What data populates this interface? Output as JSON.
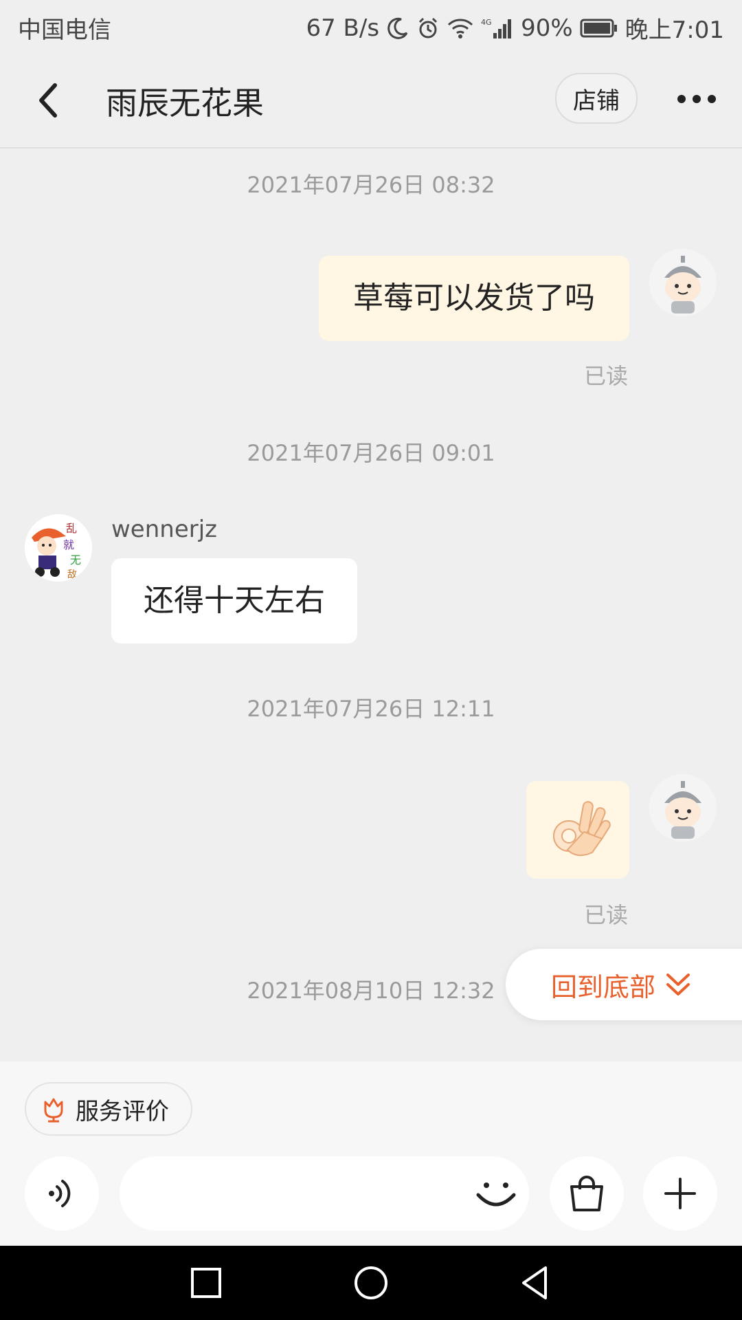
{
  "status_bar": {
    "carrier": "中国电信",
    "net_speed": "67 B/s",
    "network": "4G",
    "battery": "90%",
    "time": "晚上7:01"
  },
  "header": {
    "title": "雨辰无花果",
    "shop_label": "店铺"
  },
  "messages": [
    {
      "timestamp": "2021年07月26日 08:32",
      "text": "草莓可以发货了吗",
      "read": "已读"
    },
    {
      "timestamp": "2021年07月26日 09:01",
      "sender": "wennerjz",
      "text": "还得十天左右"
    },
    {
      "timestamp": "2021年07月26日 12:11",
      "read": "已读"
    },
    {
      "timestamp": "2021年08月10日 12:32"
    }
  ],
  "back_to_bottom": "回到底部",
  "service_chip": "服务评价",
  "input": {
    "placeholder": ""
  },
  "colors": {
    "accent": "#e8612c",
    "my_bubble": "#fff6e3",
    "their_bubble": "#ffffff",
    "background": "#efefef"
  }
}
